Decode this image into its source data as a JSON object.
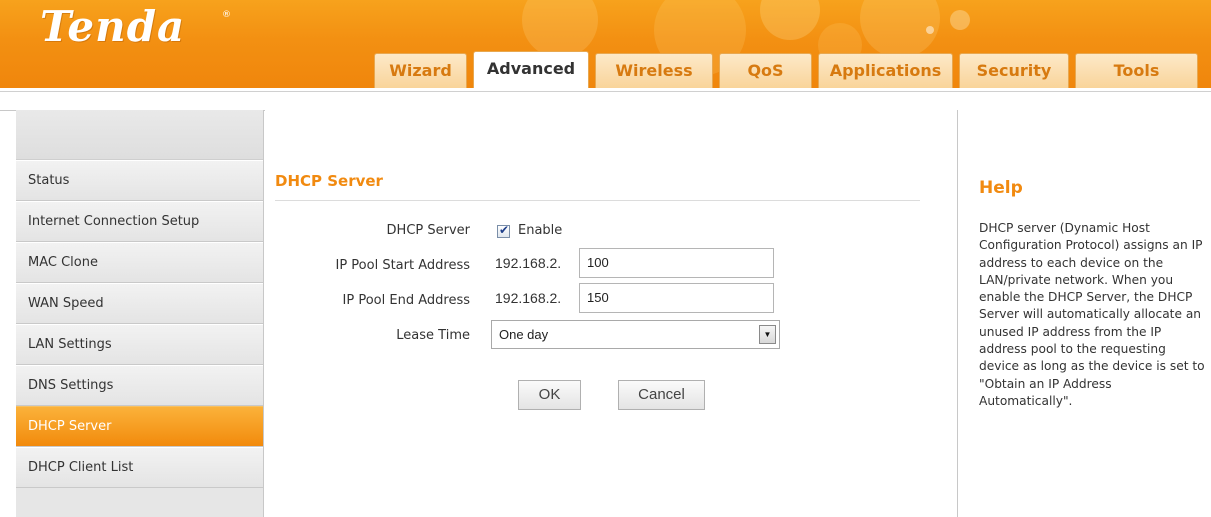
{
  "header": {
    "logo_text": "Tenda",
    "logo_mark": "®",
    "tabs": [
      {
        "label": "Wizard",
        "active": false
      },
      {
        "label": "Advanced",
        "active": true
      },
      {
        "label": "Wireless",
        "active": false
      },
      {
        "label": "QoS",
        "active": false
      },
      {
        "label": "Applications",
        "active": false
      },
      {
        "label": "Security",
        "active": false
      },
      {
        "label": "Tools",
        "active": false
      }
    ]
  },
  "sidebar": {
    "items": [
      {
        "label": "Status",
        "active": false
      },
      {
        "label": "Internet Connection Setup",
        "active": false
      },
      {
        "label": "MAC Clone",
        "active": false
      },
      {
        "label": "WAN Speed",
        "active": false
      },
      {
        "label": "LAN Settings",
        "active": false
      },
      {
        "label": "DNS Settings",
        "active": false
      },
      {
        "label": "DHCP Server",
        "active": true
      },
      {
        "label": "DHCP Client List",
        "active": false
      }
    ]
  },
  "main": {
    "section_title": "DHCP Server",
    "dhcp_server": {
      "label": "DHCP Server",
      "checked": true,
      "enable_label": "Enable"
    },
    "pool_start": {
      "label": "IP Pool Start Address",
      "prefix": "192.168.2.",
      "value": "100"
    },
    "pool_end": {
      "label": "IP Pool End Address",
      "prefix": "192.168.2.",
      "value": "150"
    },
    "lease_time": {
      "label": "Lease Time",
      "selected": "One day"
    },
    "ok_label": "OK",
    "cancel_label": "Cancel"
  },
  "help": {
    "title": "Help",
    "text": "DHCP server (Dynamic Host Configuration Protocol) assigns an IP address to each device on the LAN/private network. When you enable the DHCP Server, the DHCP Server will automatically allocate an unused IP address from the IP address pool to the requesting device as long as the device is set to \"Obtain an IP Address Automatically\"."
  },
  "colors": {
    "brand_orange": "#f39012",
    "title_orange": "#f18a10",
    "tab_inactive_text": "#d77a10"
  }
}
